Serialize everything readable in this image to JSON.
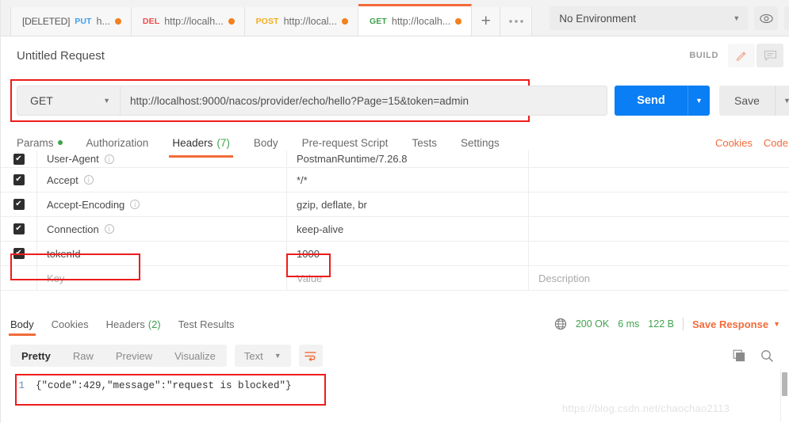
{
  "window": {
    "watermark": "https://blog.csdn.net/chaochao2113"
  },
  "tabbar": {
    "tabs": [
      {
        "prefix": "[DELETED]",
        "method": "PUT",
        "url": "h...",
        "unsaved": true,
        "active": false
      },
      {
        "prefix": "",
        "method": "DEL",
        "url": "http://localh...",
        "unsaved": true,
        "active": false
      },
      {
        "prefix": "",
        "method": "POST",
        "url": "http://local...",
        "unsaved": true,
        "active": false
      },
      {
        "prefix": "",
        "method": "GET",
        "url": "http://localh...",
        "unsaved": true,
        "active": true
      }
    ],
    "new_tab_label": "+",
    "more_label": "000",
    "environment": "No Environment",
    "env_caret": "▼",
    "eye_icon": "eye-icon",
    "settings_icon": "sliders-icon"
  },
  "request": {
    "title": "Untitled Request",
    "build_label": "BUILD",
    "edit_icon": "pencil-icon",
    "comment_icon": "comment-icon",
    "method": "GET",
    "method_caret": "▼",
    "url": "http://localhost:9000/nacos/provider/echo/hello?Page=15&token=admin",
    "send_label": "Send",
    "send_caret": "▼",
    "save_label": "Save",
    "save_caret": "▼",
    "tabs": [
      {
        "label": "Params",
        "dot": true,
        "count": "",
        "active": false
      },
      {
        "label": "Authorization",
        "dot": false,
        "count": "",
        "active": false
      },
      {
        "label": "Headers",
        "dot": false,
        "count": "(7)",
        "active": true
      },
      {
        "label": "Body",
        "dot": false,
        "count": "",
        "active": false
      },
      {
        "label": "Pre-request Script",
        "dot": false,
        "count": "",
        "active": false
      },
      {
        "label": "Tests",
        "dot": false,
        "count": "",
        "active": false
      },
      {
        "label": "Settings",
        "dot": false,
        "count": "",
        "active": false
      }
    ],
    "cookies_label": "Cookies",
    "code_label": "Code"
  },
  "headers_table": {
    "columns": {
      "key": "Key",
      "value": "Value",
      "description": "Description"
    },
    "rows": [
      {
        "checked": true,
        "key": "User-Agent",
        "info": true,
        "value": "PostmanRuntime/7.26.8",
        "description": "",
        "clipped": true
      },
      {
        "checked": true,
        "key": "Accept",
        "info": true,
        "value": "*/*",
        "description": ""
      },
      {
        "checked": true,
        "key": "Accept-Encoding",
        "info": true,
        "value": "gzip, deflate, br",
        "description": ""
      },
      {
        "checked": true,
        "key": "Connection",
        "info": true,
        "value": "keep-alive",
        "description": ""
      },
      {
        "checked": true,
        "key": "tokenId",
        "info": false,
        "value": "1000",
        "description": ""
      }
    ],
    "empty_row": {
      "key": "Key",
      "value": "Value",
      "description": "Description"
    }
  },
  "response": {
    "tabs": [
      {
        "label": "Body",
        "count": "",
        "active": true
      },
      {
        "label": "Cookies",
        "count": "",
        "active": false
      },
      {
        "label": "Headers",
        "count": "(2)",
        "active": false
      },
      {
        "label": "Test Results",
        "count": "",
        "active": false
      }
    ],
    "globe_icon": "globe-icon",
    "status": "200 OK",
    "time": "6 ms",
    "size": "122 B",
    "save_response_label": "Save Response",
    "save_response_caret": "▼",
    "viewer_modes": [
      {
        "label": "Pretty",
        "active": true
      },
      {
        "label": "Raw",
        "active": false
      },
      {
        "label": "Preview",
        "active": false
      },
      {
        "label": "Visualize",
        "active": false
      }
    ],
    "format": "Text",
    "format_caret": "▼",
    "wrap_icon": "word-wrap-icon",
    "copy_icon": "copy-icon",
    "search_icon": "search-icon",
    "body_line_number": "1",
    "body_text": "{\"code\":429,\"message\":\"request is blocked\"}"
  },
  "colors": {
    "accent_orange": "#f26b3a",
    "send_blue": "#0a7ef4",
    "success_green": "#3fa34d",
    "annotation_red": "#ee1c1c",
    "unsaved_dot": "#f2811d"
  }
}
